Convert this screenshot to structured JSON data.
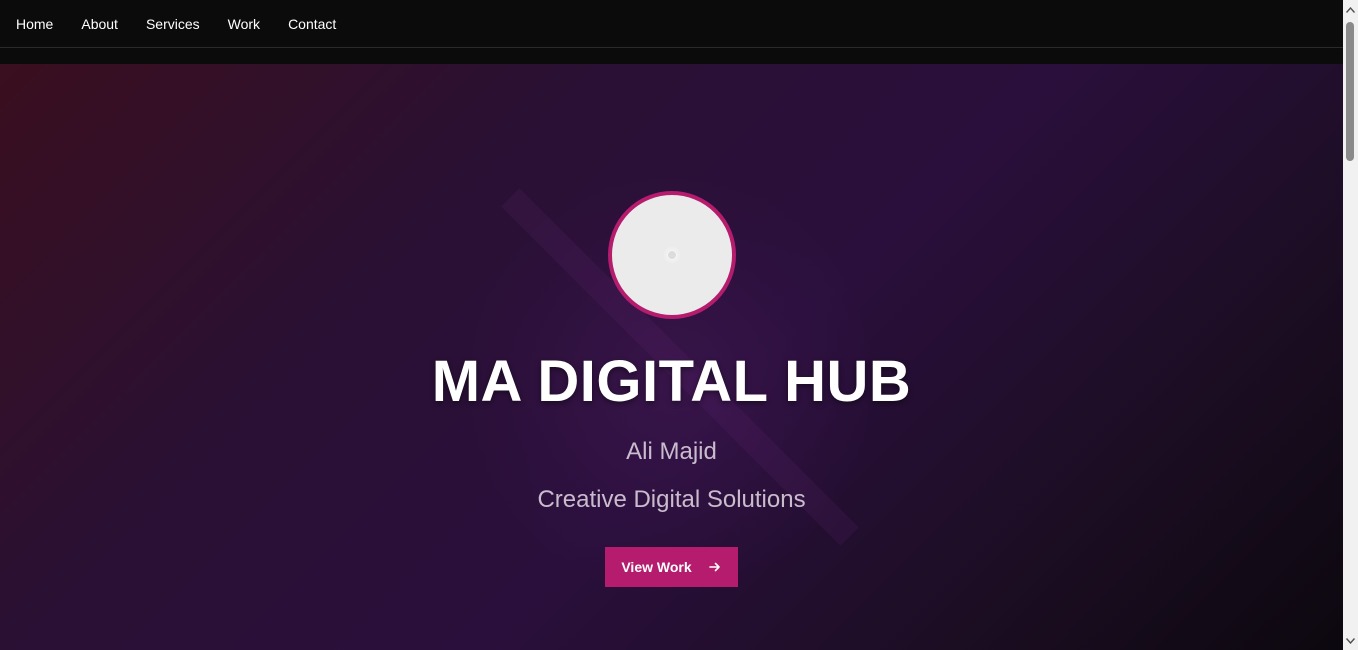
{
  "nav": {
    "items": [
      {
        "label": "Home"
      },
      {
        "label": "About"
      },
      {
        "label": "Services"
      },
      {
        "label": "Work"
      },
      {
        "label": "Contact"
      }
    ]
  },
  "hero": {
    "title": "MA DIGITAL HUB",
    "name": "Ali Majid",
    "tagline": "Creative Digital Solutions",
    "cta_label": "View Work",
    "cta_icon": "arrow-right-icon",
    "avatar_icon": "avatar-placeholder-icon"
  },
  "colors": {
    "accent": "#b51c6e",
    "nav_background": "#0b0b0b",
    "hero_gradient_start": "#3a0f1f",
    "hero_gradient_mid": "#2a0f3c",
    "hero_gradient_end": "#0c080f",
    "title_text": "#ffffff",
    "subtitle_text": "#c9bccd"
  }
}
